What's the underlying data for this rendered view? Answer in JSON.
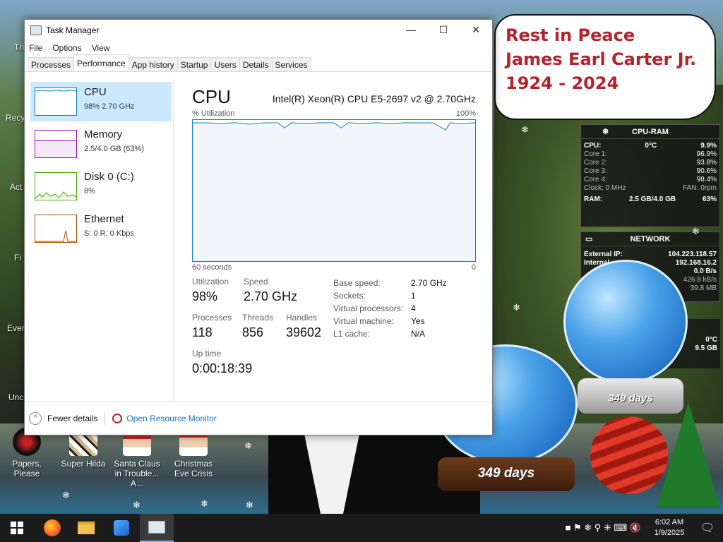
{
  "desktop": {
    "left_labels": [
      "Thi",
      "Recy",
      "Act",
      "Fi",
      "Ever",
      "Unc"
    ],
    "icons": [
      {
        "label": "Papers, Please"
      },
      {
        "label": "Super Hilda"
      },
      {
        "label": "Santa Claus in Trouble... A..."
      },
      {
        "label": "Christmas Eve Crisis"
      }
    ],
    "bubble_lines": [
      "Rest in Peace",
      "James Earl Carter Jr.",
      "1924 - 2024"
    ],
    "globe_days_left": "349 days",
    "globe_days_right": "349 days"
  },
  "task_manager": {
    "title": "Task Manager",
    "menu": [
      "File",
      "Options",
      "View"
    ],
    "tabs": [
      "Processes",
      "Performance",
      "App history",
      "Startup",
      "Users",
      "Details",
      "Services"
    ],
    "active_tab": "Performance",
    "resources": [
      {
        "name": "CPU",
        "sub": "98%  2.70 GHz",
        "color": "#117dbb"
      },
      {
        "name": "Memory",
        "sub": "2.5/4.0 GB (63%)",
        "color": "#8b12ae"
      },
      {
        "name": "Disk 0 (C:)",
        "sub": "8%",
        "color": "#4da60c"
      },
      {
        "name": "Ethernet",
        "sub": "S: 0  R: 0 Kbps",
        "color": "#a74f01"
      }
    ],
    "cpu": {
      "header": "CPU",
      "model": "Intel(R) Xeon(R) CPU E5-2697 v2 @ 2.70GHz",
      "util_label": "% Utilization",
      "max_label": "100%",
      "time_label": "60 seconds",
      "min_label": "0",
      "utilization_label": "Utilization",
      "utilization": "98%",
      "speed_label": "Speed",
      "speed": "2.70 GHz",
      "processes_label": "Processes",
      "processes": "118",
      "threads_label": "Threads",
      "threads": "856",
      "handles_label": "Handles",
      "handles": "39602",
      "uptime_label": "Up time",
      "uptime": "0:00:18:39",
      "specs": [
        {
          "k": "Base speed:",
          "v": "2.70 GHz"
        },
        {
          "k": "Sockets:",
          "v": "1"
        },
        {
          "k": "Virtual processors:",
          "v": "4"
        },
        {
          "k": "Virtual machine:",
          "v": "Yes"
        },
        {
          "k": "L1 cache:",
          "v": "N/A"
        }
      ]
    },
    "footer": {
      "fewer": "Fewer details",
      "orm": "Open Resource Monitor"
    }
  },
  "gadget_cpu": {
    "title": "CPU-RAM",
    "cpu_label": "CPU:",
    "cpu_temp": "0°C",
    "cpu_val": "9.9%",
    "cores": [
      {
        "k": "Core 1:",
        "v": "96.9%"
      },
      {
        "k": "Core 2:",
        "v": "93.8%"
      },
      {
        "k": "Core 3:",
        "v": "90.6%"
      },
      {
        "k": "Core 4:",
        "v": "98.4%"
      }
    ],
    "clock": "Clock: 0 MHz",
    "fan": "FAN: 0rpm",
    "ram_label": "RAM:",
    "ram": "2.5 GB/4.0 GB",
    "ram_pct": "63%"
  },
  "gadget_net": {
    "title": "NETWORK",
    "ext_label": "External IP:",
    "ext": "104.223.118.57",
    "int_label": "Internal",
    "int": "192.168.16.2",
    "rate": "0.0 B/s",
    "a": "426.8 kB/s",
    "b": "39.8 MB",
    "temp": "0°C",
    "size": "9.5 GB"
  },
  "taskbar": {
    "time": "6:02 AM",
    "date": "1/9/2025"
  },
  "colors": {
    "accent": "#117dbb",
    "selected": "#cce8ff",
    "memorial": "#b3232d"
  }
}
